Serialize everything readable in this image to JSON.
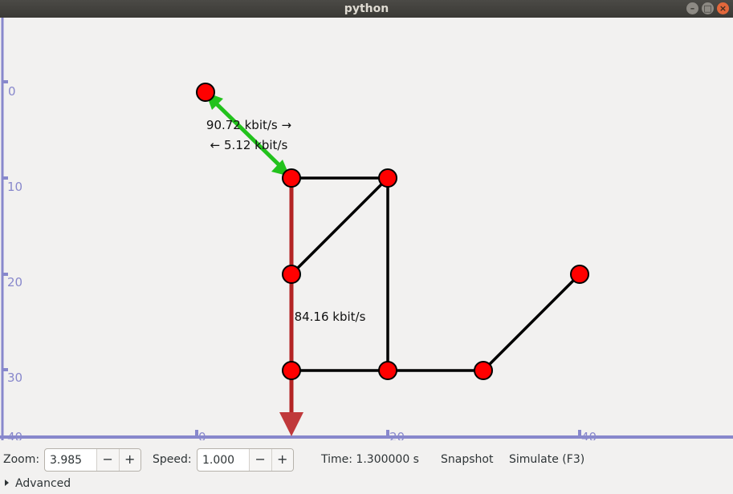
{
  "window": {
    "title": "python"
  },
  "axes": {
    "y_ticks": [
      "0",
      "10",
      "20",
      "30",
      "40"
    ],
    "x_ticks": [
      "0",
      "20",
      "40"
    ],
    "axis_color": "#8888cc"
  },
  "graph": {
    "link_label_top": "90.72 kbit/s →",
    "link_label_bottom": "← 5.12 kbit/s",
    "link_label_vertical": "84.16 kbit/s"
  },
  "toolbar": {
    "zoom_label": "Zoom:",
    "zoom_value": "3.985",
    "speed_label": "Speed:",
    "speed_value": "1.000",
    "minus": "−",
    "plus": "+",
    "time_text": "Time: 1.300000 s",
    "snapshot_label": "Snapshot",
    "simulate_label": "Simulate (F3)"
  },
  "advanced": {
    "label": "Advanced"
  }
}
